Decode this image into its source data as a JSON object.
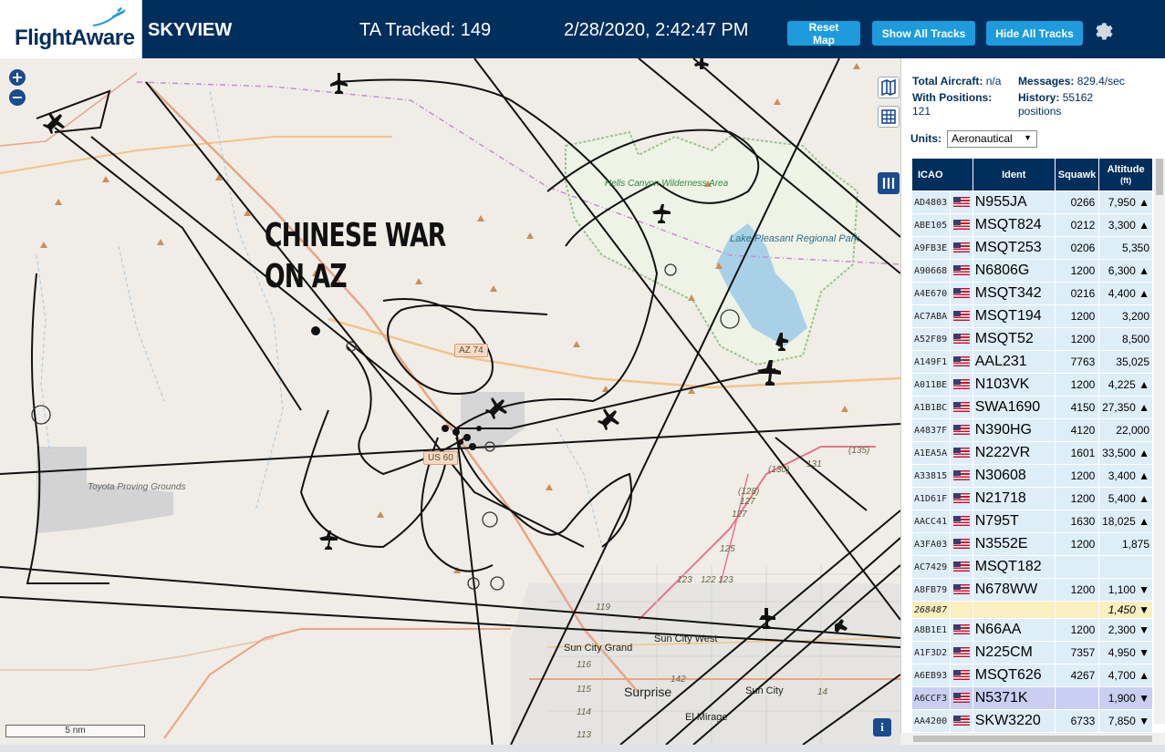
{
  "header": {
    "logo_text": "FlightAware",
    "app_name": "SKYVIEW",
    "tracked": "TA Tracked: 149",
    "datetime": "2/28/2020, 2:42:47 PM",
    "buttons": {
      "reset": "Reset Map",
      "show_all": "Show All Tracks",
      "hide_all": "Hide All Tracks"
    },
    "settings_icon": "gear-icon"
  },
  "map": {
    "overlay_title": "CHINESE WAR\nON AZ",
    "zoom_in": "+",
    "zoom_out": "−",
    "scale": "5 nm",
    "info": "i",
    "labels": {
      "hells_canyon": "Hells Canyon\nWilderness\nArea",
      "lake_pleasant": "Lake Pleasant\nRegional\nPark",
      "toyota": "Toyota\nProving\nGrounds",
      "sun_city_grand": "Sun City Grand",
      "sun_city_west": "Sun City West",
      "sun_city": "Sun City",
      "surprise": "Surprise",
      "el_mirage": "El Mirage"
    },
    "shields": {
      "az74": "AZ 74",
      "us60": "US 60"
    },
    "route_numbers": [
      "(135)",
      "(130)",
      "131",
      "(128)",
      "127",
      "127",
      "125",
      "123",
      "119",
      "116",
      "115",
      "114",
      "113",
      "142",
      "123",
      "122",
      "14"
    ]
  },
  "stats": {
    "total_aircraft_label": "Total Aircraft:",
    "total_aircraft_value": "n/a",
    "messages_label": "Messages:",
    "messages_value": "829.4/sec",
    "with_positions_label": "With Positions:",
    "with_positions_value": "121",
    "history_label": "History:",
    "history_value": "55162",
    "history_unit": "positions"
  },
  "units": {
    "label": "Units:",
    "selected": "Aeronautical"
  },
  "table": {
    "headers": {
      "icao": "ICAO",
      "ident": "Ident",
      "squawk": "Squawk",
      "altitude": "Altitude",
      "altitude_unit": "(ft)"
    },
    "rows": [
      {
        "icao": "AD4803",
        "ident": "N955JA",
        "squawk": "0266",
        "alt": "7,950 ▲"
      },
      {
        "icao": "ABE105",
        "ident": "MSQT824",
        "squawk": "0212",
        "alt": "3,300 ▲"
      },
      {
        "icao": "A9FB3E",
        "ident": "MSQT253",
        "squawk": "0206",
        "alt": "5,350"
      },
      {
        "icao": "A90668",
        "ident": "N6806G",
        "squawk": "1200",
        "alt": "6,300 ▲"
      },
      {
        "icao": "A4E670",
        "ident": "MSQT342",
        "squawk": "0216",
        "alt": "4,400 ▲"
      },
      {
        "icao": "AC7ABA",
        "ident": "MSQT194",
        "squawk": "1200",
        "alt": "3,200"
      },
      {
        "icao": "A52F89",
        "ident": "MSQT52",
        "squawk": "1200",
        "alt": "8,500"
      },
      {
        "icao": "A149F1",
        "ident": "AAL231",
        "squawk": "7763",
        "alt": "35,025"
      },
      {
        "icao": "A011BE",
        "ident": "N103VK",
        "squawk": "1200",
        "alt": "4,225 ▲"
      },
      {
        "icao": "A1B1BC",
        "ident": "SWA1690",
        "squawk": "4150",
        "alt": "27,350 ▲"
      },
      {
        "icao": "A4837F",
        "ident": "N390HG",
        "squawk": "4120",
        "alt": "22,000"
      },
      {
        "icao": "A1EA5A",
        "ident": "N222VR",
        "squawk": "1601",
        "alt": "33,500 ▲"
      },
      {
        "icao": "A33815",
        "ident": "N30608",
        "squawk": "1200",
        "alt": "3,400 ▲"
      },
      {
        "icao": "A1D61F",
        "ident": "N21718",
        "squawk": "1200",
        "alt": "5,400 ▲"
      },
      {
        "icao": "AACC41",
        "ident": "N795T",
        "squawk": "1630",
        "alt": "18,025 ▲"
      },
      {
        "icao": "A3FA03",
        "ident": "N3552E",
        "squawk": "1200",
        "alt": "1,875"
      },
      {
        "icao": "AC7429",
        "ident": "MSQT182",
        "squawk": "",
        "alt": ""
      },
      {
        "icao": "A8FB79",
        "ident": "N678WW",
        "squawk": "1200",
        "alt": "1,100 ▼"
      },
      {
        "icao": "268487",
        "ident": "",
        "squawk": "",
        "alt": "1,450 ▼",
        "style": "noident"
      },
      {
        "icao": "A8B1E1",
        "ident": "N66AA",
        "squawk": "1200",
        "alt": "2,300 ▼"
      },
      {
        "icao": "A1F3D2",
        "ident": "N225CM",
        "squawk": "7357",
        "alt": "4,950 ▼"
      },
      {
        "icao": "A6EB93",
        "ident": "MSQT626",
        "squawk": "4267",
        "alt": "4,700 ▲"
      },
      {
        "icao": "A6CCF3",
        "ident": "N5371K",
        "squawk": "",
        "alt": "1,900 ▼",
        "style": "selected"
      },
      {
        "icao": "AA4200",
        "ident": "SKW3220",
        "squawk": "6733",
        "alt": "7,850 ▼"
      }
    ]
  },
  "colors": {
    "header_bg": "#002f5d",
    "button_bg": "#1e9bdc",
    "row_bg": "#deeef9",
    "selected_row": "#c9cff3",
    "noident_row": "#fbeec0",
    "map_bg": "#efede6",
    "water": "#a8d1e8",
    "park_border": "#9dc38d"
  }
}
